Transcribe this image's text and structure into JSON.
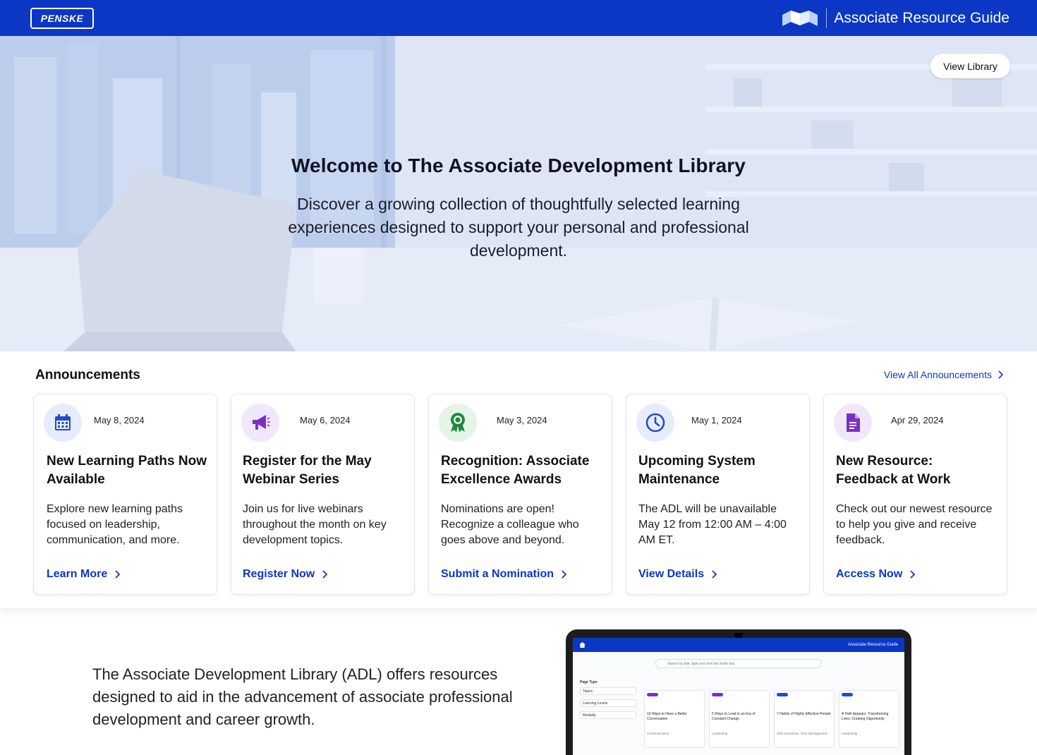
{
  "header": {
    "logo_text": "PENSKE",
    "brand_icon": "open-book-icon",
    "title": "Associate Resource Guide"
  },
  "hero": {
    "view_library_label": "View Library",
    "title": "Welcome to The Associate Development Library",
    "subtitle": "Discover a growing collection of thoughtfully selected learning experiences designed to support your personal and professional development."
  },
  "announcements": {
    "heading": "Announcements",
    "view_all_label": "View All Announcements",
    "cards": [
      {
        "icon": "calendar-icon",
        "icon_color": "#1f4bd1",
        "icon_bg": "#e6ecfb",
        "date": "May 8, 2024",
        "title": "New Learning Paths Now Available",
        "description": "Explore new learning paths focused on leadership, communication, and more.",
        "link_label": "Learn More"
      },
      {
        "icon": "megaphone-icon",
        "icon_color": "#7b2ec7",
        "icon_bg": "#f1e7fa",
        "date": "May 6, 2024",
        "title": "Register for the May Webinar Series",
        "description": "Join us for live webinars throughout the month on key development topics.",
        "link_label": "Register Now"
      },
      {
        "icon": "award-ribbon-icon",
        "icon_color": "#1f8a3a",
        "icon_bg": "#e5f4e9",
        "date": "May 3, 2024",
        "title": "Recognition: Associate Excellence Awards",
        "description": "Nominations are open! Recognize a colleague who goes above and beyond.",
        "link_label": "Submit a Nomination"
      },
      {
        "icon": "clock-icon",
        "icon_color": "#1f4bd1",
        "icon_bg": "#e6ecfb",
        "date": "May 1, 2024",
        "title": "Upcoming System Maintenance",
        "description": "The ADL will be unavailable May 12 from 12:00 AM – 4:00 AM ET.",
        "link_label": "View Details"
      },
      {
        "icon": "document-icon",
        "icon_color": "#7b2ec7",
        "icon_bg": "#f1e7fa",
        "date": "Apr 29, 2024",
        "title": "New Resource: Feedback at Work",
        "description": "Check out our newest resource to help you give and receive feedback.",
        "link_label": "Access Now"
      }
    ]
  },
  "about": {
    "text": "The Associate Development Library (ADL) offers resources designed to aid in the advancement of associate professional development and career growth."
  },
  "preview": {
    "brand": "Associate Resource Guide",
    "search_placeholder": "Search by title, type and sent the Enter key",
    "sidebar_label": "Page Type",
    "filters": [
      "Topics",
      "Learning Levels",
      "Modality"
    ],
    "cards": [
      {
        "pill_color": "#7b2ec7",
        "title": "10 Ways to Have a Better Conversation",
        "tag": "Communication"
      },
      {
        "pill_color": "#7b2ec7",
        "title": "5 Ways to Lead in an Era of Constant Change",
        "tag": "Leadership"
      },
      {
        "pill_color": "#1f4bd1",
        "title": "7 Habits of Highly Effective People",
        "tag": "Self-Awareness, Time Management"
      },
      {
        "pill_color": "#1f4bd1",
        "title": "A Path Appears: Transforming Lives, Creating Opportunity",
        "tag": "Leadership"
      }
    ]
  },
  "colors": {
    "brand_blue": "#0b37c4",
    "link_blue": "#0b37c4"
  }
}
